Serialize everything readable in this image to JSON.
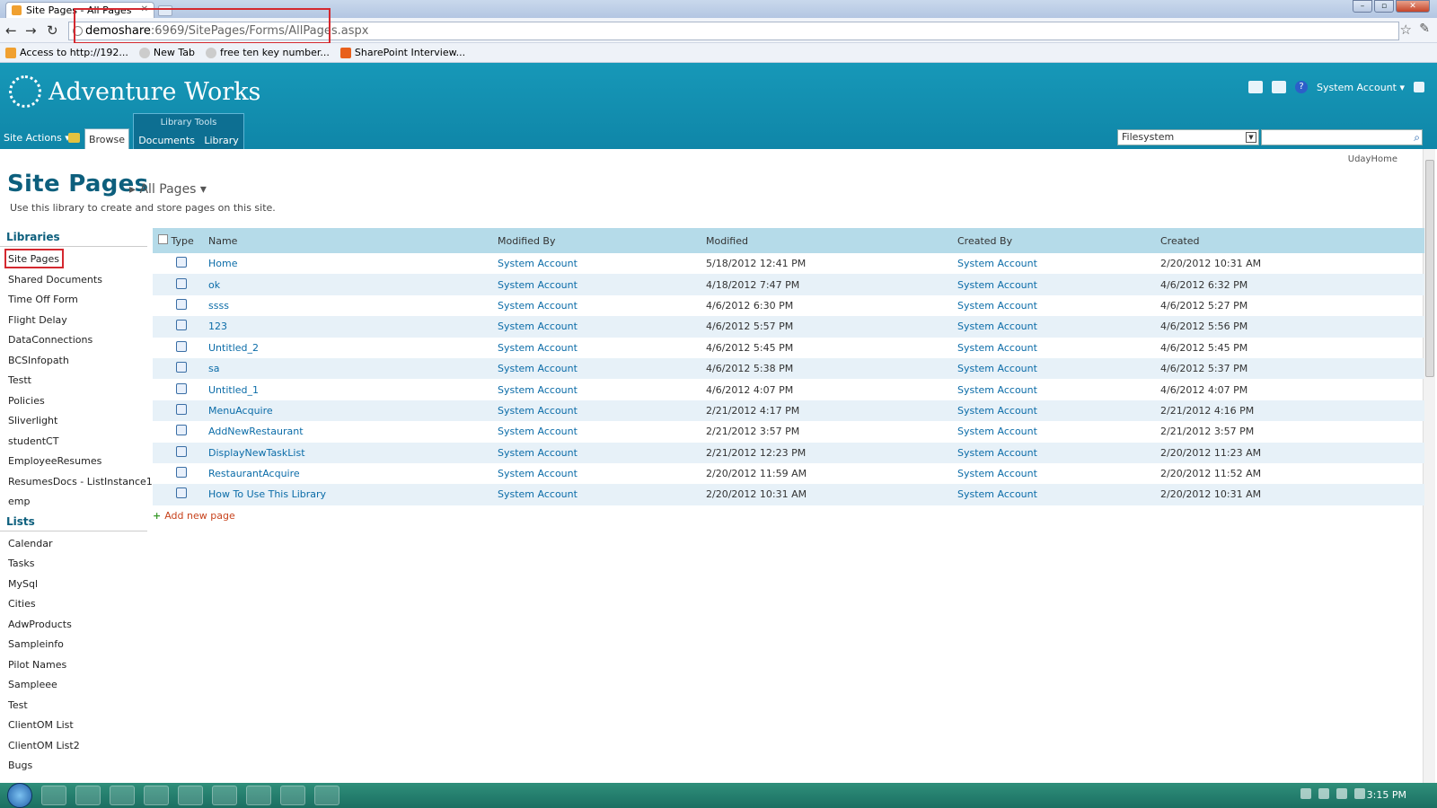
{
  "browser": {
    "tab_title": "Site Pages - All Pages",
    "url_host": "demoshare",
    "url_rest": ":6969/SitePages/Forms/AllPages.aspx",
    "bookmarks": [
      "Access to http://192...",
      "New Tab",
      "free ten key number...",
      "SharePoint Interview..."
    ]
  },
  "site": {
    "logo_text": "Adventure Works",
    "user": "System Account",
    "site_actions": "Site Actions",
    "browse_tab": "Browse",
    "library_tools": "Library Tools",
    "documents_tab": "Documents",
    "library_tab": "Library",
    "search_scope": "Filesystem",
    "home_link": "UdayHome"
  },
  "page": {
    "title": "Site Pages",
    "view": "All Pages",
    "description": "Use this library to create and store pages on this site.",
    "add_new": "Add new page"
  },
  "leftnav": {
    "libraries_heading": "Libraries",
    "libraries": [
      "Site Pages",
      "Shared Documents",
      "Time Off Form",
      "Flight Delay",
      "DataConnections",
      "BCSInfopath",
      "Testt",
      "Policies",
      "Sliverlight",
      "studentCT",
      "EmployeeResumes",
      "ResumesDocs - ListInstance1",
      "emp"
    ],
    "lists_heading": "Lists",
    "lists": [
      "Calendar",
      "Tasks",
      "MySql",
      "Cities",
      "AdwProducts",
      "Sampleinfo",
      "Pilot Names",
      "Sampleee",
      "Test",
      "ClientOM List",
      "ClientOM List2",
      "Bugs"
    ]
  },
  "grid": {
    "columns": [
      "Type",
      "Name",
      "Modified By",
      "Modified",
      "Created By",
      "Created"
    ],
    "rows": [
      {
        "name": "Home",
        "modified_by": "System Account",
        "modified": "5/18/2012 12:41 PM",
        "created_by": "System Account",
        "created": "2/20/2012 10:31 AM"
      },
      {
        "name": "ok",
        "modified_by": "System Account",
        "modified": "4/18/2012 7:47 PM",
        "created_by": "System Account",
        "created": "4/6/2012 6:32 PM"
      },
      {
        "name": "ssss",
        "modified_by": "System Account",
        "modified": "4/6/2012 6:30 PM",
        "created_by": "System Account",
        "created": "4/6/2012 5:27 PM"
      },
      {
        "name": "123",
        "modified_by": "System Account",
        "modified": "4/6/2012 5:57 PM",
        "created_by": "System Account",
        "created": "4/6/2012 5:56 PM"
      },
      {
        "name": "Untitled_2",
        "modified_by": "System Account",
        "modified": "4/6/2012 5:45 PM",
        "created_by": "System Account",
        "created": "4/6/2012 5:45 PM"
      },
      {
        "name": "sa",
        "modified_by": "System Account",
        "modified": "4/6/2012 5:38 PM",
        "created_by": "System Account",
        "created": "4/6/2012 5:37 PM"
      },
      {
        "name": "Untitled_1",
        "modified_by": "System Account",
        "modified": "4/6/2012 4:07 PM",
        "created_by": "System Account",
        "created": "4/6/2012 4:07 PM"
      },
      {
        "name": "MenuAcquire",
        "modified_by": "System Account",
        "modified": "2/21/2012 4:17 PM",
        "created_by": "System Account",
        "created": "2/21/2012 4:16 PM"
      },
      {
        "name": "AddNewRestaurant",
        "modified_by": "System Account",
        "modified": "2/21/2012 3:57 PM",
        "created_by": "System Account",
        "created": "2/21/2012 3:57 PM"
      },
      {
        "name": "DisplayNewTaskList",
        "modified_by": "System Account",
        "modified": "2/21/2012 12:23 PM",
        "created_by": "System Account",
        "created": "2/20/2012 11:23 AM"
      },
      {
        "name": "RestaurantAcquire",
        "modified_by": "System Account",
        "modified": "2/20/2012 11:59 AM",
        "created_by": "System Account",
        "created": "2/20/2012 11:52 AM"
      },
      {
        "name": "How To Use This Library",
        "modified_by": "System Account",
        "modified": "2/20/2012 10:31 AM",
        "created_by": "System Account",
        "created": "2/20/2012 10:31 AM"
      }
    ]
  },
  "taskbar": {
    "clock": "3:15 PM"
  },
  "colors": {
    "accent": "#1798b8",
    "link": "#0b6ca8",
    "title": "#0d5f7d",
    "highlight_box": "#d4282f"
  }
}
